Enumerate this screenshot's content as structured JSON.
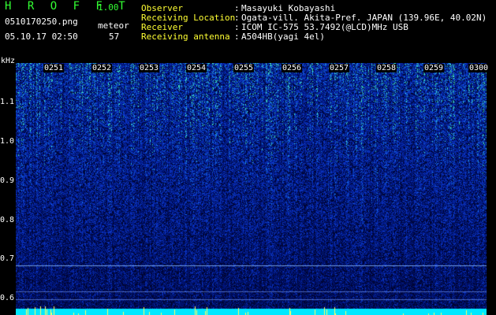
{
  "header": {
    "app_title": "H R O F F T",
    "app_version": "1.00",
    "file_name": "0510170250.png",
    "meteor_label": "meteor",
    "date_time": "05.10.17 02:50",
    "meteor_count": "57",
    "info": [
      {
        "label": "Observer",
        "value": "Masayuki Kobayashi"
      },
      {
        "label": "Receiving Location",
        "value": "Ogata-vill. Akita-Pref. JAPAN (139.96E, 40.02N)"
      },
      {
        "label": "Receiver",
        "value": "ICOM IC-575 53.7492(@LCD)MHz USB"
      },
      {
        "label": "Receiving antenna",
        "value": "A504HB(yagi 4el)"
      }
    ],
    "colon": ":"
  },
  "spectrogram": {
    "y_unit": "kHz",
    "y_ticks": [
      "1.1",
      "1.0",
      "0.9",
      "0.8",
      "0.7",
      "0.6"
    ],
    "x_ticks": [
      "0251",
      "0252",
      "0253",
      "0254",
      "0255",
      "0256",
      "0257",
      "0258",
      "0259",
      "0300"
    ],
    "colors": {
      "background": "#000000",
      "low": "#001060",
      "mid": "#1030c0",
      "high": "#20d0c0",
      "peak": "#e0f040",
      "marker": "#ffff66",
      "baseline": "#00e8ff"
    }
  }
}
